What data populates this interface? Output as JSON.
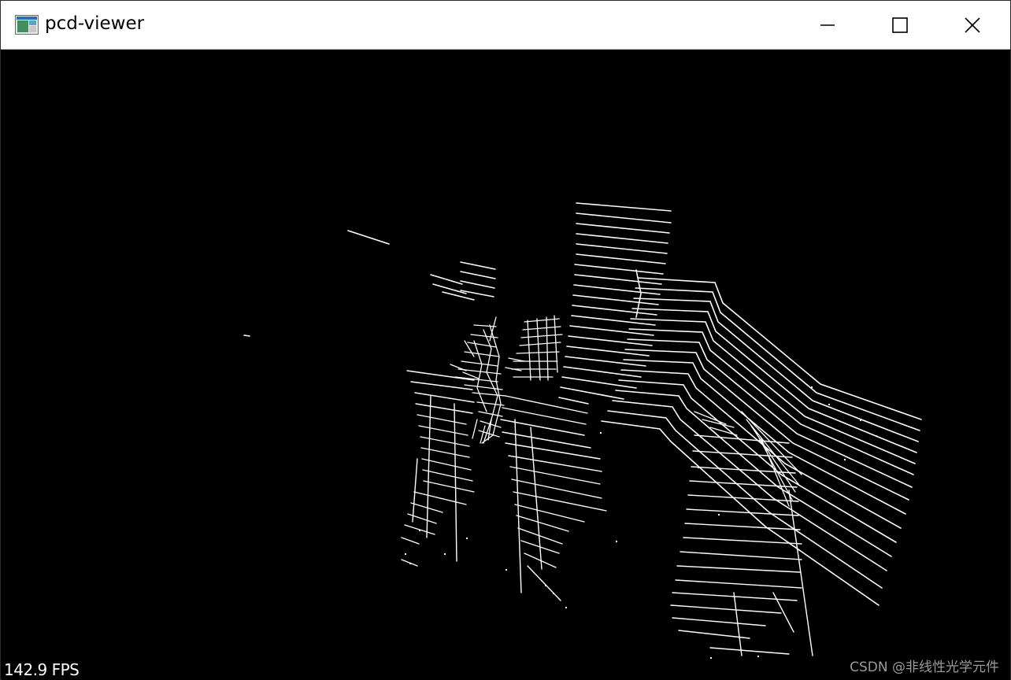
{
  "window": {
    "title": "pcd-viewer",
    "icon": "app-window-icon",
    "controls": [
      "minimize-icon",
      "maximize-icon",
      "close-icon"
    ]
  },
  "viewer": {
    "background": "#000000",
    "point_color": "#ffffff",
    "fps_label": "142.9 FPS"
  },
  "watermark": "CSDN @非线性光学元件",
  "colors": {
    "titlebar": "#ffffff",
    "accent": "#0078d7",
    "watermark": "#9a9a9a"
  }
}
